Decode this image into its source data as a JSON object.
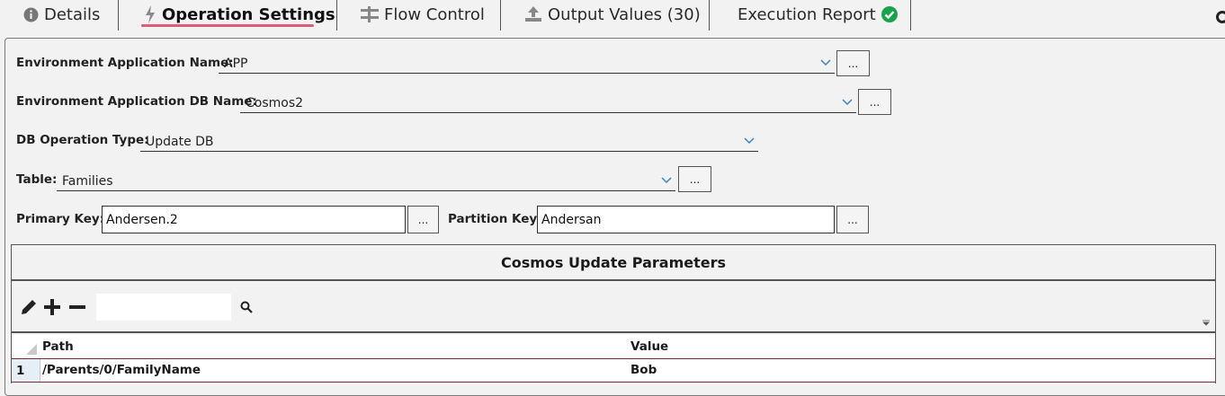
{
  "tabs": [
    {
      "label": "Details",
      "icon": "info-icon"
    },
    {
      "label": "Operation Settings",
      "icon": "lightning-icon",
      "active": true
    },
    {
      "label": "Flow Control",
      "icon": "flow-icon"
    },
    {
      "label": "Output Values (30)",
      "icon": "upload-icon"
    },
    {
      "label": "Execution Report",
      "icon": "check-circle-icon"
    }
  ],
  "form": {
    "env_app_label": "Environment Application Name:",
    "env_app_value": "APP",
    "env_db_label": "Environment Application DB Name:",
    "env_db_value": "Cosmos2",
    "op_type_label": "DB Operation Type:",
    "op_type_value": "Update DB",
    "table_label": "Table:",
    "table_value": "Families",
    "primary_key_label": "Primary Key:",
    "primary_key_value": "Andersen.2",
    "partition_key_label": "Partition Key:",
    "partition_key_value": "Andersan",
    "dots": "..."
  },
  "grid": {
    "title": "Cosmos Update Parameters",
    "search_value": "",
    "columns": [
      "Path",
      "Value"
    ],
    "rows": [
      {
        "num": "1",
        "path": "/Parents/0/FamilyName",
        "value": "Bob"
      }
    ]
  },
  "colors": {
    "accent_underline": "#e05a7a",
    "check_green": "#1aa34a",
    "row_border": "#7a2a35"
  }
}
